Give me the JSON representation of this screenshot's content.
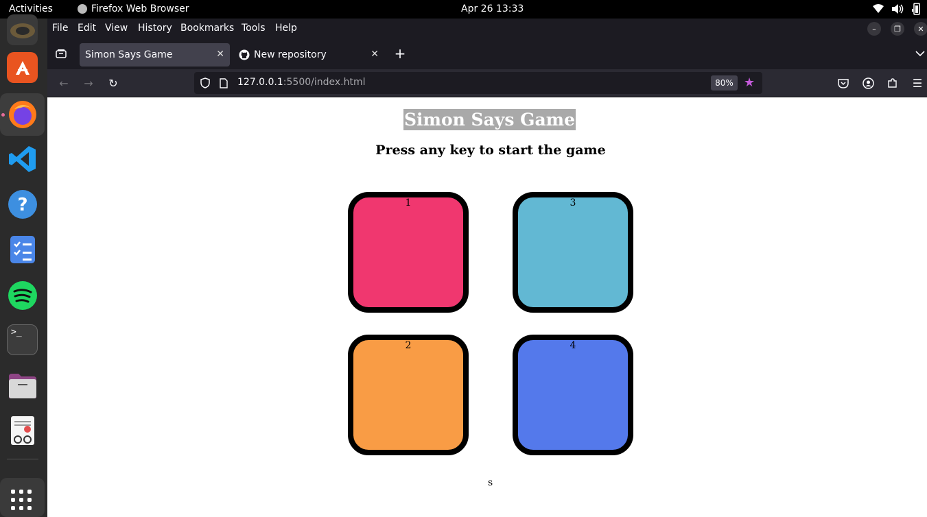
{
  "system_bar": {
    "activities": "Activities",
    "app_name": "Firefox Web Browser",
    "clock": "Apr 26  13:33"
  },
  "menu": [
    "File",
    "Edit",
    "View",
    "History",
    "Bookmarks",
    "Tools",
    "Help"
  ],
  "tabs": [
    {
      "label": "Simon Says Game",
      "active": true
    },
    {
      "label": "New repository",
      "active": false
    }
  ],
  "address": {
    "host": "127.0.0.1",
    "path": ":5500/index.html",
    "zoom": "80%"
  },
  "page": {
    "title": "Simon Says Game",
    "subtitle": "Press any key to start the game",
    "boxes": [
      {
        "label": "1",
        "color": "#f0376f"
      },
      {
        "label": "3",
        "color": "#62b8d3"
      },
      {
        "label": "2",
        "color": "#f99c45"
      },
      {
        "label": "4",
        "color": "#5479eb"
      }
    ],
    "footnote": "s"
  },
  "dock_icons": [
    "rhythmbox-icon",
    "app-center-icon",
    "firefox-icon",
    "vscode-icon",
    "help-icon",
    "tasks-icon",
    "spotify-icon",
    "terminal-icon",
    "files-icon",
    "text-editor-icon",
    "show-apps-icon"
  ]
}
